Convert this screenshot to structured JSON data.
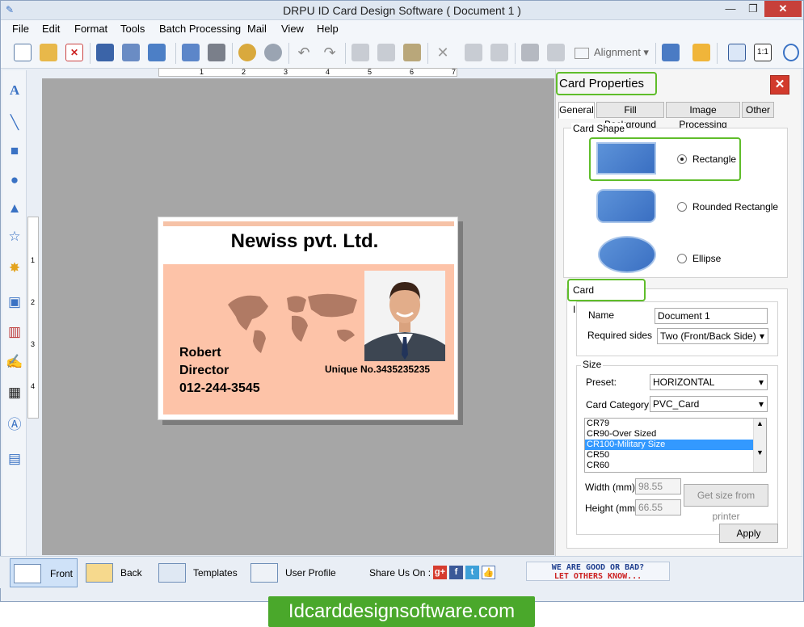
{
  "window": {
    "title": "DRPU ID Card Design Software ( Document 1 )"
  },
  "menu": [
    "File",
    "Edit",
    "Format",
    "Tools",
    "Batch Processing",
    "Mail",
    "View",
    "Help"
  ],
  "toolbar": {
    "alignment_label": "Alignment"
  },
  "ruler": {
    "h_ticks": [
      "1",
      "2",
      "3",
      "4",
      "5",
      "6",
      "7"
    ],
    "v_ticks": [
      "1",
      "2",
      "3",
      "4"
    ]
  },
  "card": {
    "company": "Newiss pvt. Ltd.",
    "name": "Robert",
    "role": "Director",
    "phone": "012-244-3545",
    "unique": "Unique No.3435235235"
  },
  "panel": {
    "title": "Card Properties",
    "tabs": [
      "General",
      "Fill Background",
      "Image Processing",
      "Other"
    ],
    "card_shape": {
      "label": "Card Shape",
      "options": [
        "Rectangle",
        "Rounded Rectangle",
        "Ellipse"
      ],
      "selected": "Rectangle"
    },
    "card_info": {
      "label": "Card Information",
      "name_label": "Name",
      "name_value": "Document 1",
      "sides_label": "Required sides",
      "sides_value": "Two (Front/Back Side)"
    },
    "size": {
      "label": "Size",
      "preset_label": "Preset:",
      "preset_value": "HORIZONTAL",
      "category_label": "Card Category",
      "category_value": "PVC_Card",
      "list": [
        "CR79",
        "CR90-Over Sized",
        "CR100-Military Size",
        "CR50",
        "CR60"
      ],
      "selected": "CR100-Military Size",
      "width_label": "Width  (mm)",
      "width_value": "98.55",
      "height_label": "Height  (mm)",
      "height_value": "66.55",
      "printer_button": "Get size from printer",
      "apply_button": "Apply"
    }
  },
  "bottom": {
    "front": "Front",
    "back": "Back",
    "templates": "Templates",
    "user_profile": "User Profile",
    "share": "Share Us On :",
    "rate_line1": "WE ARE GOOD OR BAD?",
    "rate_line2": "LET OTHERS KNOW..."
  },
  "site": "Idcarddesignsoftware.com",
  "colors": {
    "accent_green": "#5fbd2a",
    "card_body": "#fdc3a8",
    "close_red": "#d23a2c"
  }
}
